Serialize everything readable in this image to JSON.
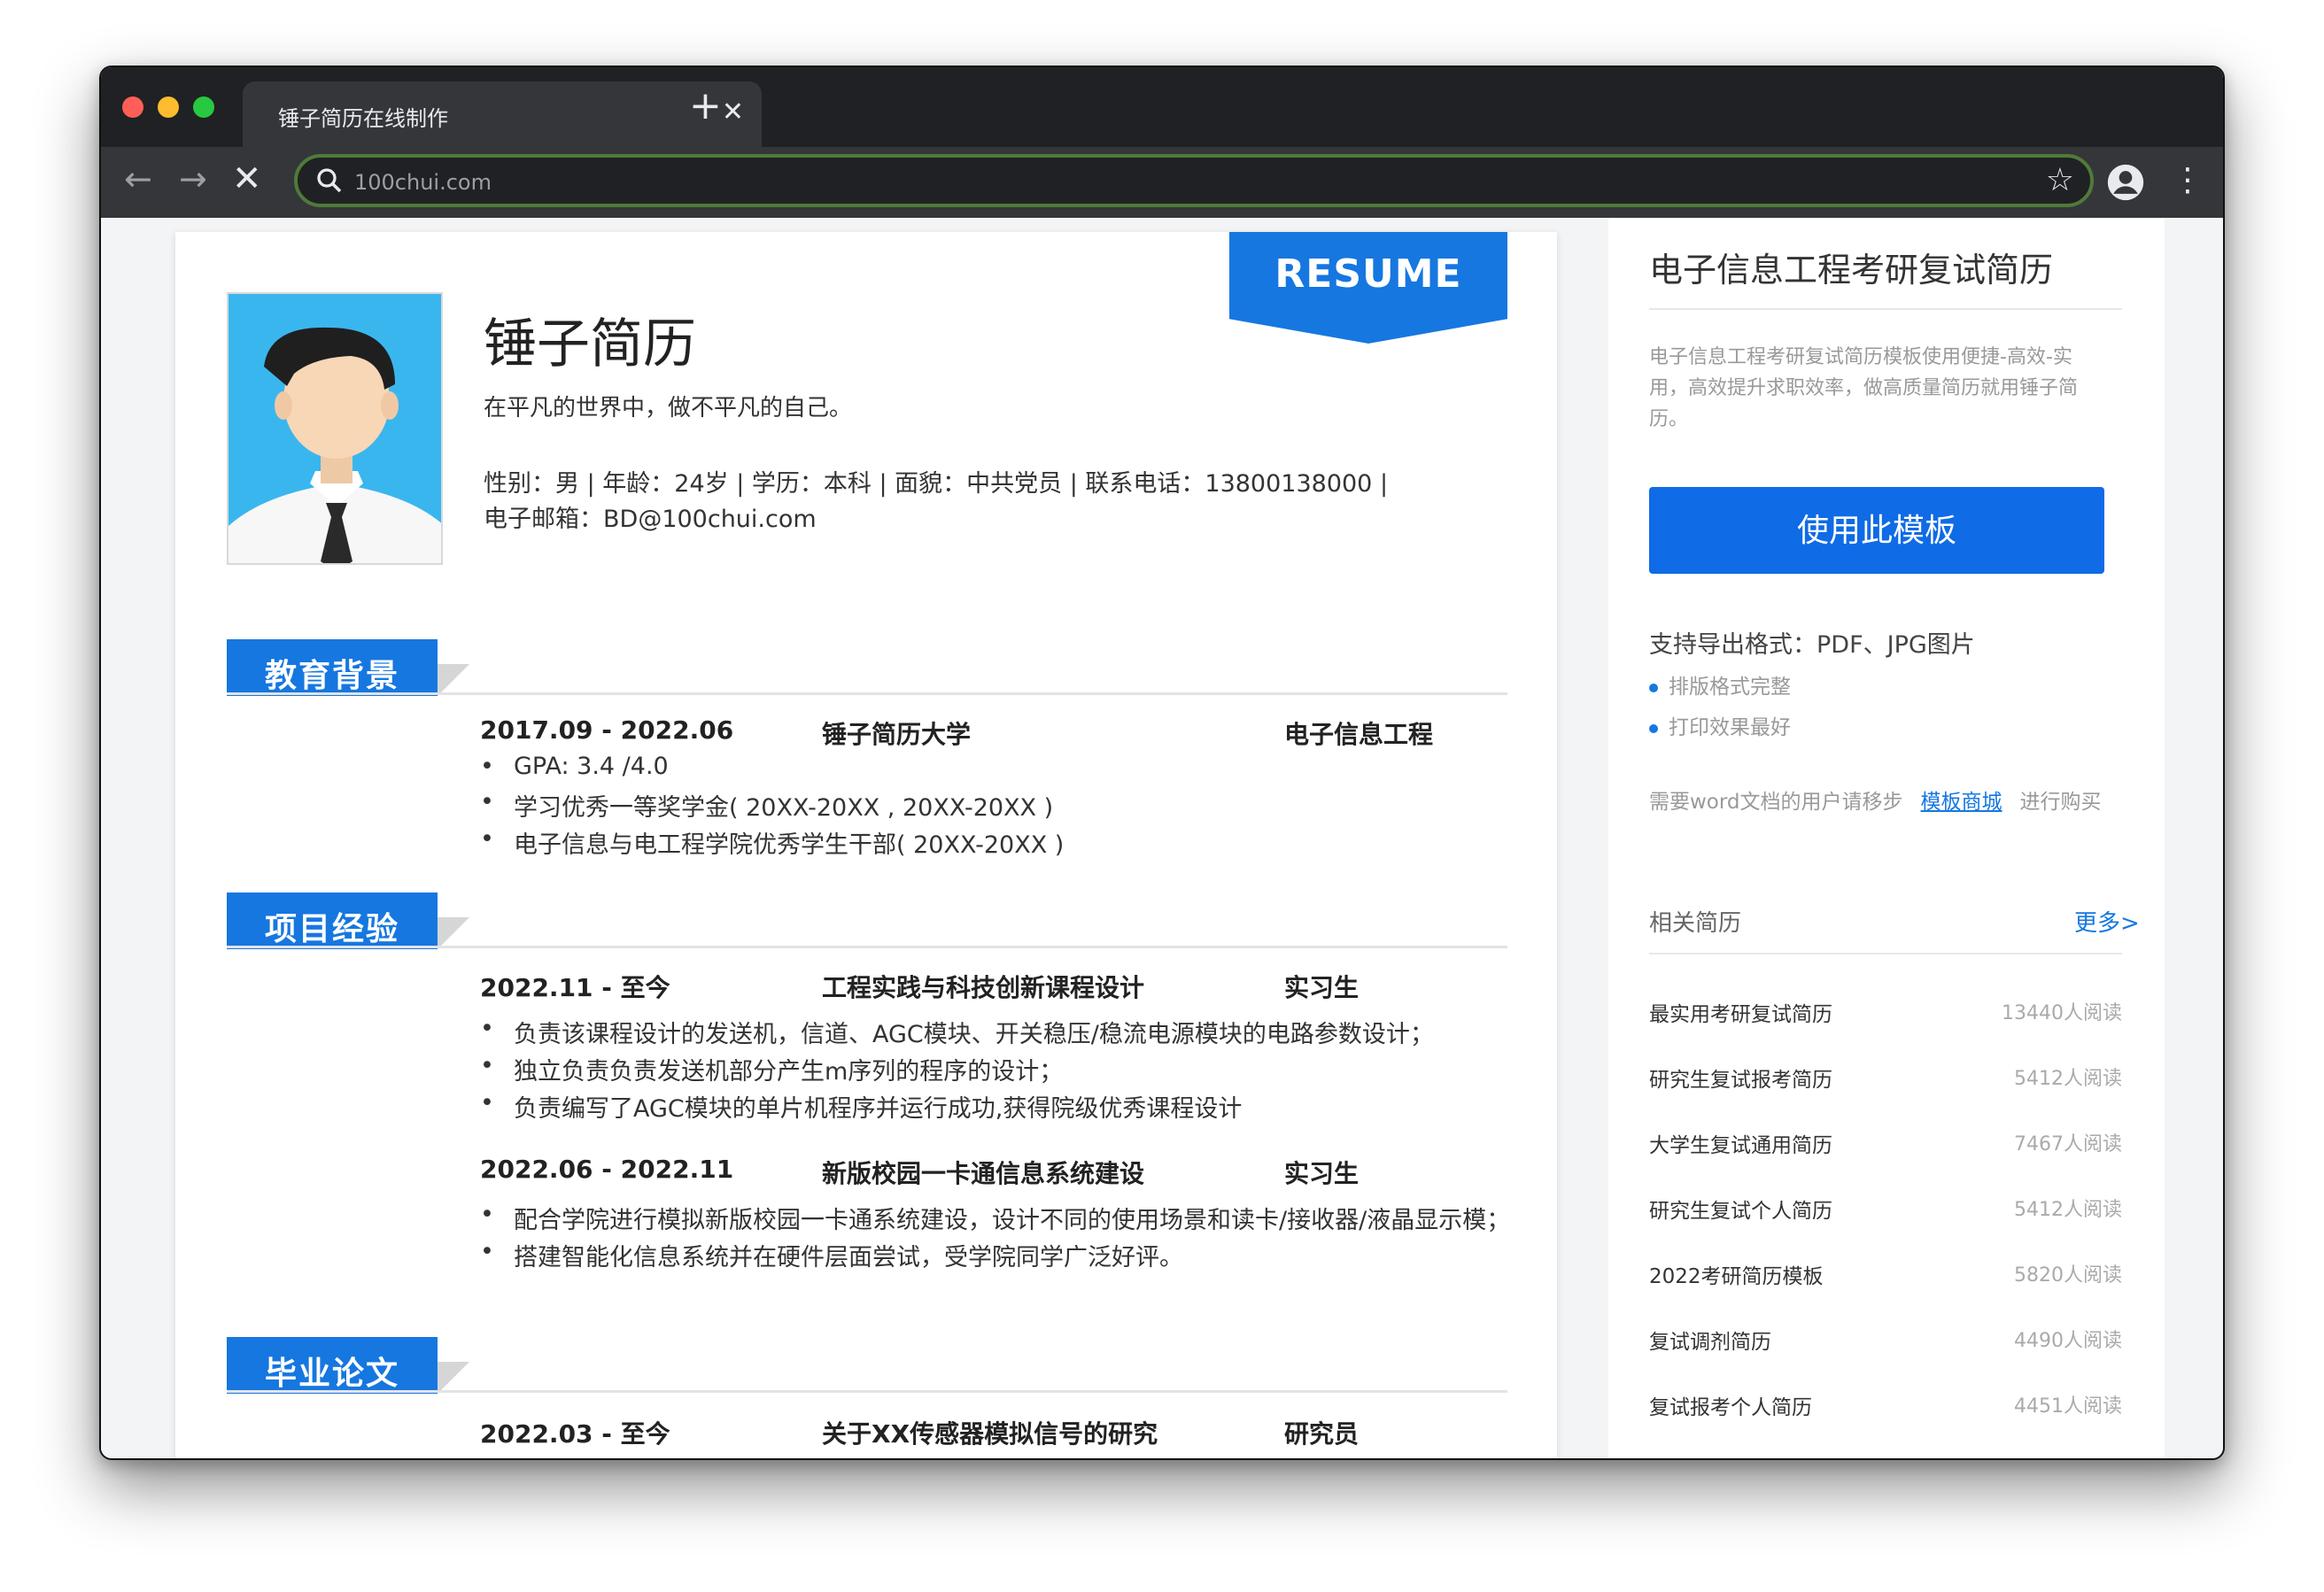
{
  "browser": {
    "tab_title": "锤子简历在线制作",
    "url": "100chui.com",
    "close_glyph": "✕",
    "new_tab_glyph": "+",
    "back_glyph": "←",
    "forward_glyph": "→",
    "stop_glyph": "✕",
    "star_glyph": "☆",
    "menu_glyph": "⋮"
  },
  "resume": {
    "ribbon": "RESUME",
    "name": "锤子简历",
    "motto": "在平凡的世界中，做不平凡的自己。",
    "info_line1": "性别：男 | 年龄：24岁 | 学历：本科 | 面貌：中共党员 | 联系电话：13800138000 |",
    "info_line2": "电子邮箱：BD@100chui.com",
    "sections": [
      {
        "title": "教育背景",
        "entries": [
          {
            "date": "2017.09 - 2022.06",
            "org": "锤子简历大学",
            "role": "电子信息工程",
            "bullets": [
              "GPA: 3.4 /4.0",
              "学习优秀一等奖学金( 20XX-20XX , 20XX-20XX )",
              "电子信息与电工程学院优秀学生干部( 20XX-20XX )"
            ]
          }
        ]
      },
      {
        "title": "项目经验",
        "entries": [
          {
            "date": "2022.11 - 至今",
            "org": "工程实践与科技创新课程设计",
            "role": "实习生",
            "bullets": [
              "负责该课程设计的发送机，信道、AGC模块、开关稳压/稳流电源模块的电路参数设计；",
              "独立负责负责发送机部分产生m序列的程序的设计；",
              "负责编写了AGC模块的单片机程序并运行成功,获得院级优秀课程设计"
            ]
          },
          {
            "date": "2022.06 - 2022.11",
            "org": "新版校园一卡通信息系统建设",
            "role": "实习生",
            "bullets": [
              "配合学院进行模拟新版校园一卡通系统建设，设计不同的使用场景和读卡/接收器/液晶显示模；",
              "搭建智能化信息系统并在硬件层面尝试，受学院同学广泛好评。"
            ]
          }
        ]
      },
      {
        "title": "毕业论文",
        "entries": [
          {
            "date": "2022.03 - 至今",
            "org": "关于XX传感器模拟信号的研究",
            "role": "研究员",
            "bullets": []
          }
        ]
      }
    ]
  },
  "sidebar": {
    "title": "电子信息工程考研复试简历",
    "description": "电子信息工程考研复试简历模板使用便捷-高效-实用，高效提升求职效率，做高质量简历就用锤子简历。",
    "use_button": "使用此模板",
    "export_title": "支持导出格式：PDF、JPG图片",
    "export_items": [
      "排版格式完整",
      "打印效果最好"
    ],
    "word_note_prefix": "需要word文档的用户请移步",
    "word_note_link": "模板商城",
    "word_note_suffix": "进行购买",
    "related_label": "相关简历",
    "more_link": "更多>",
    "related": [
      {
        "name": "最实用考研复试简历",
        "count": "13440人阅读"
      },
      {
        "name": "研究生复试报考简历",
        "count": "5412人阅读"
      },
      {
        "name": "大学生复试通用简历",
        "count": "7467人阅读"
      },
      {
        "name": "研究生复试个人简历",
        "count": "5412人阅读"
      },
      {
        "name": "2022考研简历模板",
        "count": "5820人阅读"
      },
      {
        "name": "复试调剂简历",
        "count": "4490人阅读"
      },
      {
        "name": "复试报考个人简历",
        "count": "4451人阅读"
      }
    ]
  },
  "colors": {
    "accent": "#1677e0",
    "button": "#0f6be6",
    "chrome_dark": "#202124",
    "chrome_toolbar": "#35363a"
  }
}
